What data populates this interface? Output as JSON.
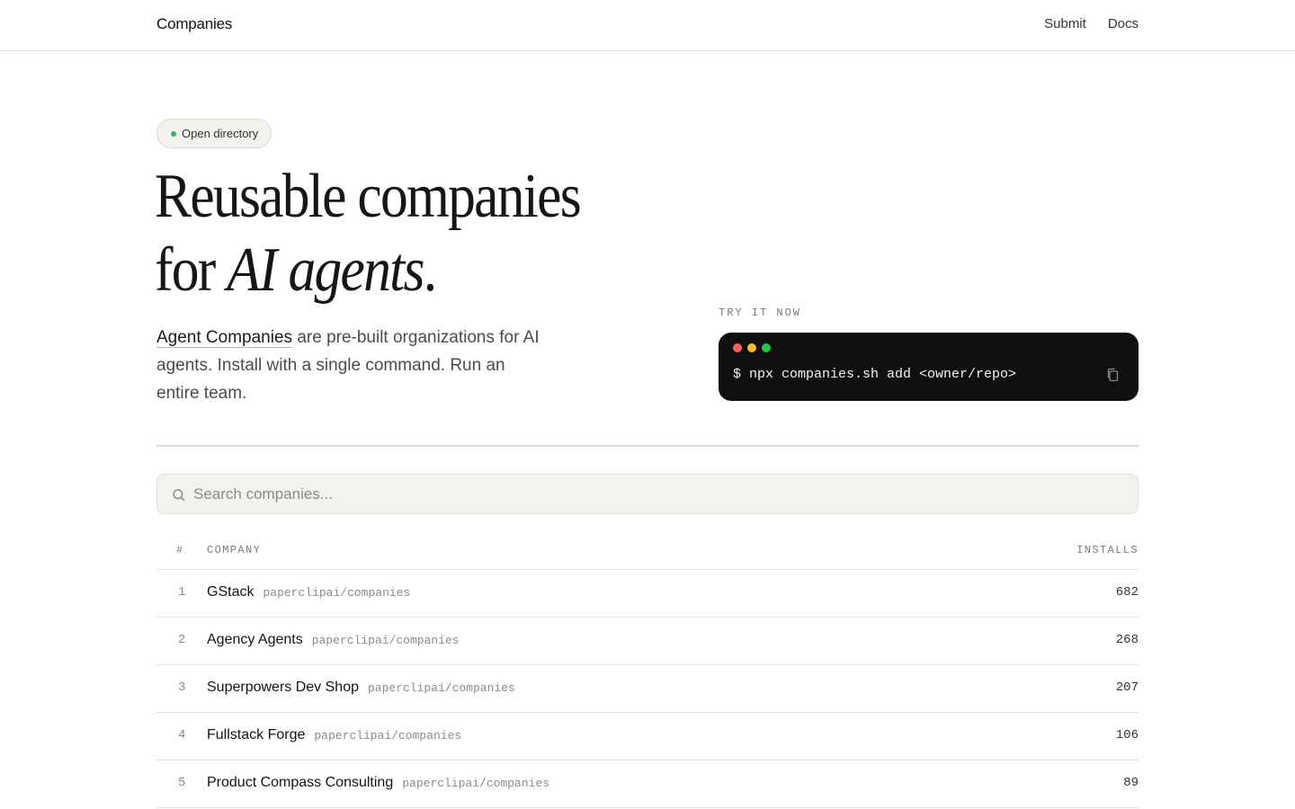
{
  "header": {
    "brand": "Companies",
    "nav": [
      {
        "label": "Submit"
      },
      {
        "label": "Docs"
      }
    ]
  },
  "hero": {
    "badge": "Open directory",
    "badge_color": "#2fb86a",
    "title_line1": "Reusable companies",
    "title_line2_prefix": "for ",
    "title_line2_emphasis": "AI agents",
    "title_line2_suffix": ".",
    "lede_link": "Agent Companies",
    "lede_text": " are pre-built organizations for AI agents. Install with a single command. Run an entire team."
  },
  "try_it": {
    "label": "TRY IT NOW",
    "command": "$ npx companies.sh add <owner/repo>",
    "copy_icon": "copy-icon",
    "lights": [
      "#ff5f57",
      "#febc2e",
      "#28c840"
    ]
  },
  "search": {
    "placeholder": "Search companies...",
    "value": ""
  },
  "table": {
    "columns": {
      "num": "#",
      "company": "COMPANY",
      "installs": "INSTALLS"
    },
    "rows": [
      {
        "num": "1",
        "name": "GStack",
        "repo": "paperclipai/companies",
        "installs": "682"
      },
      {
        "num": "2",
        "name": "Agency Agents",
        "repo": "paperclipai/companies",
        "installs": "268"
      },
      {
        "num": "3",
        "name": "Superpowers Dev Shop",
        "repo": "paperclipai/companies",
        "installs": "207"
      },
      {
        "num": "4",
        "name": "Fullstack Forge",
        "repo": "paperclipai/companies",
        "installs": "106"
      },
      {
        "num": "5",
        "name": "Product Compass Consulting",
        "repo": "paperclipai/companies",
        "installs": "89"
      }
    ]
  }
}
